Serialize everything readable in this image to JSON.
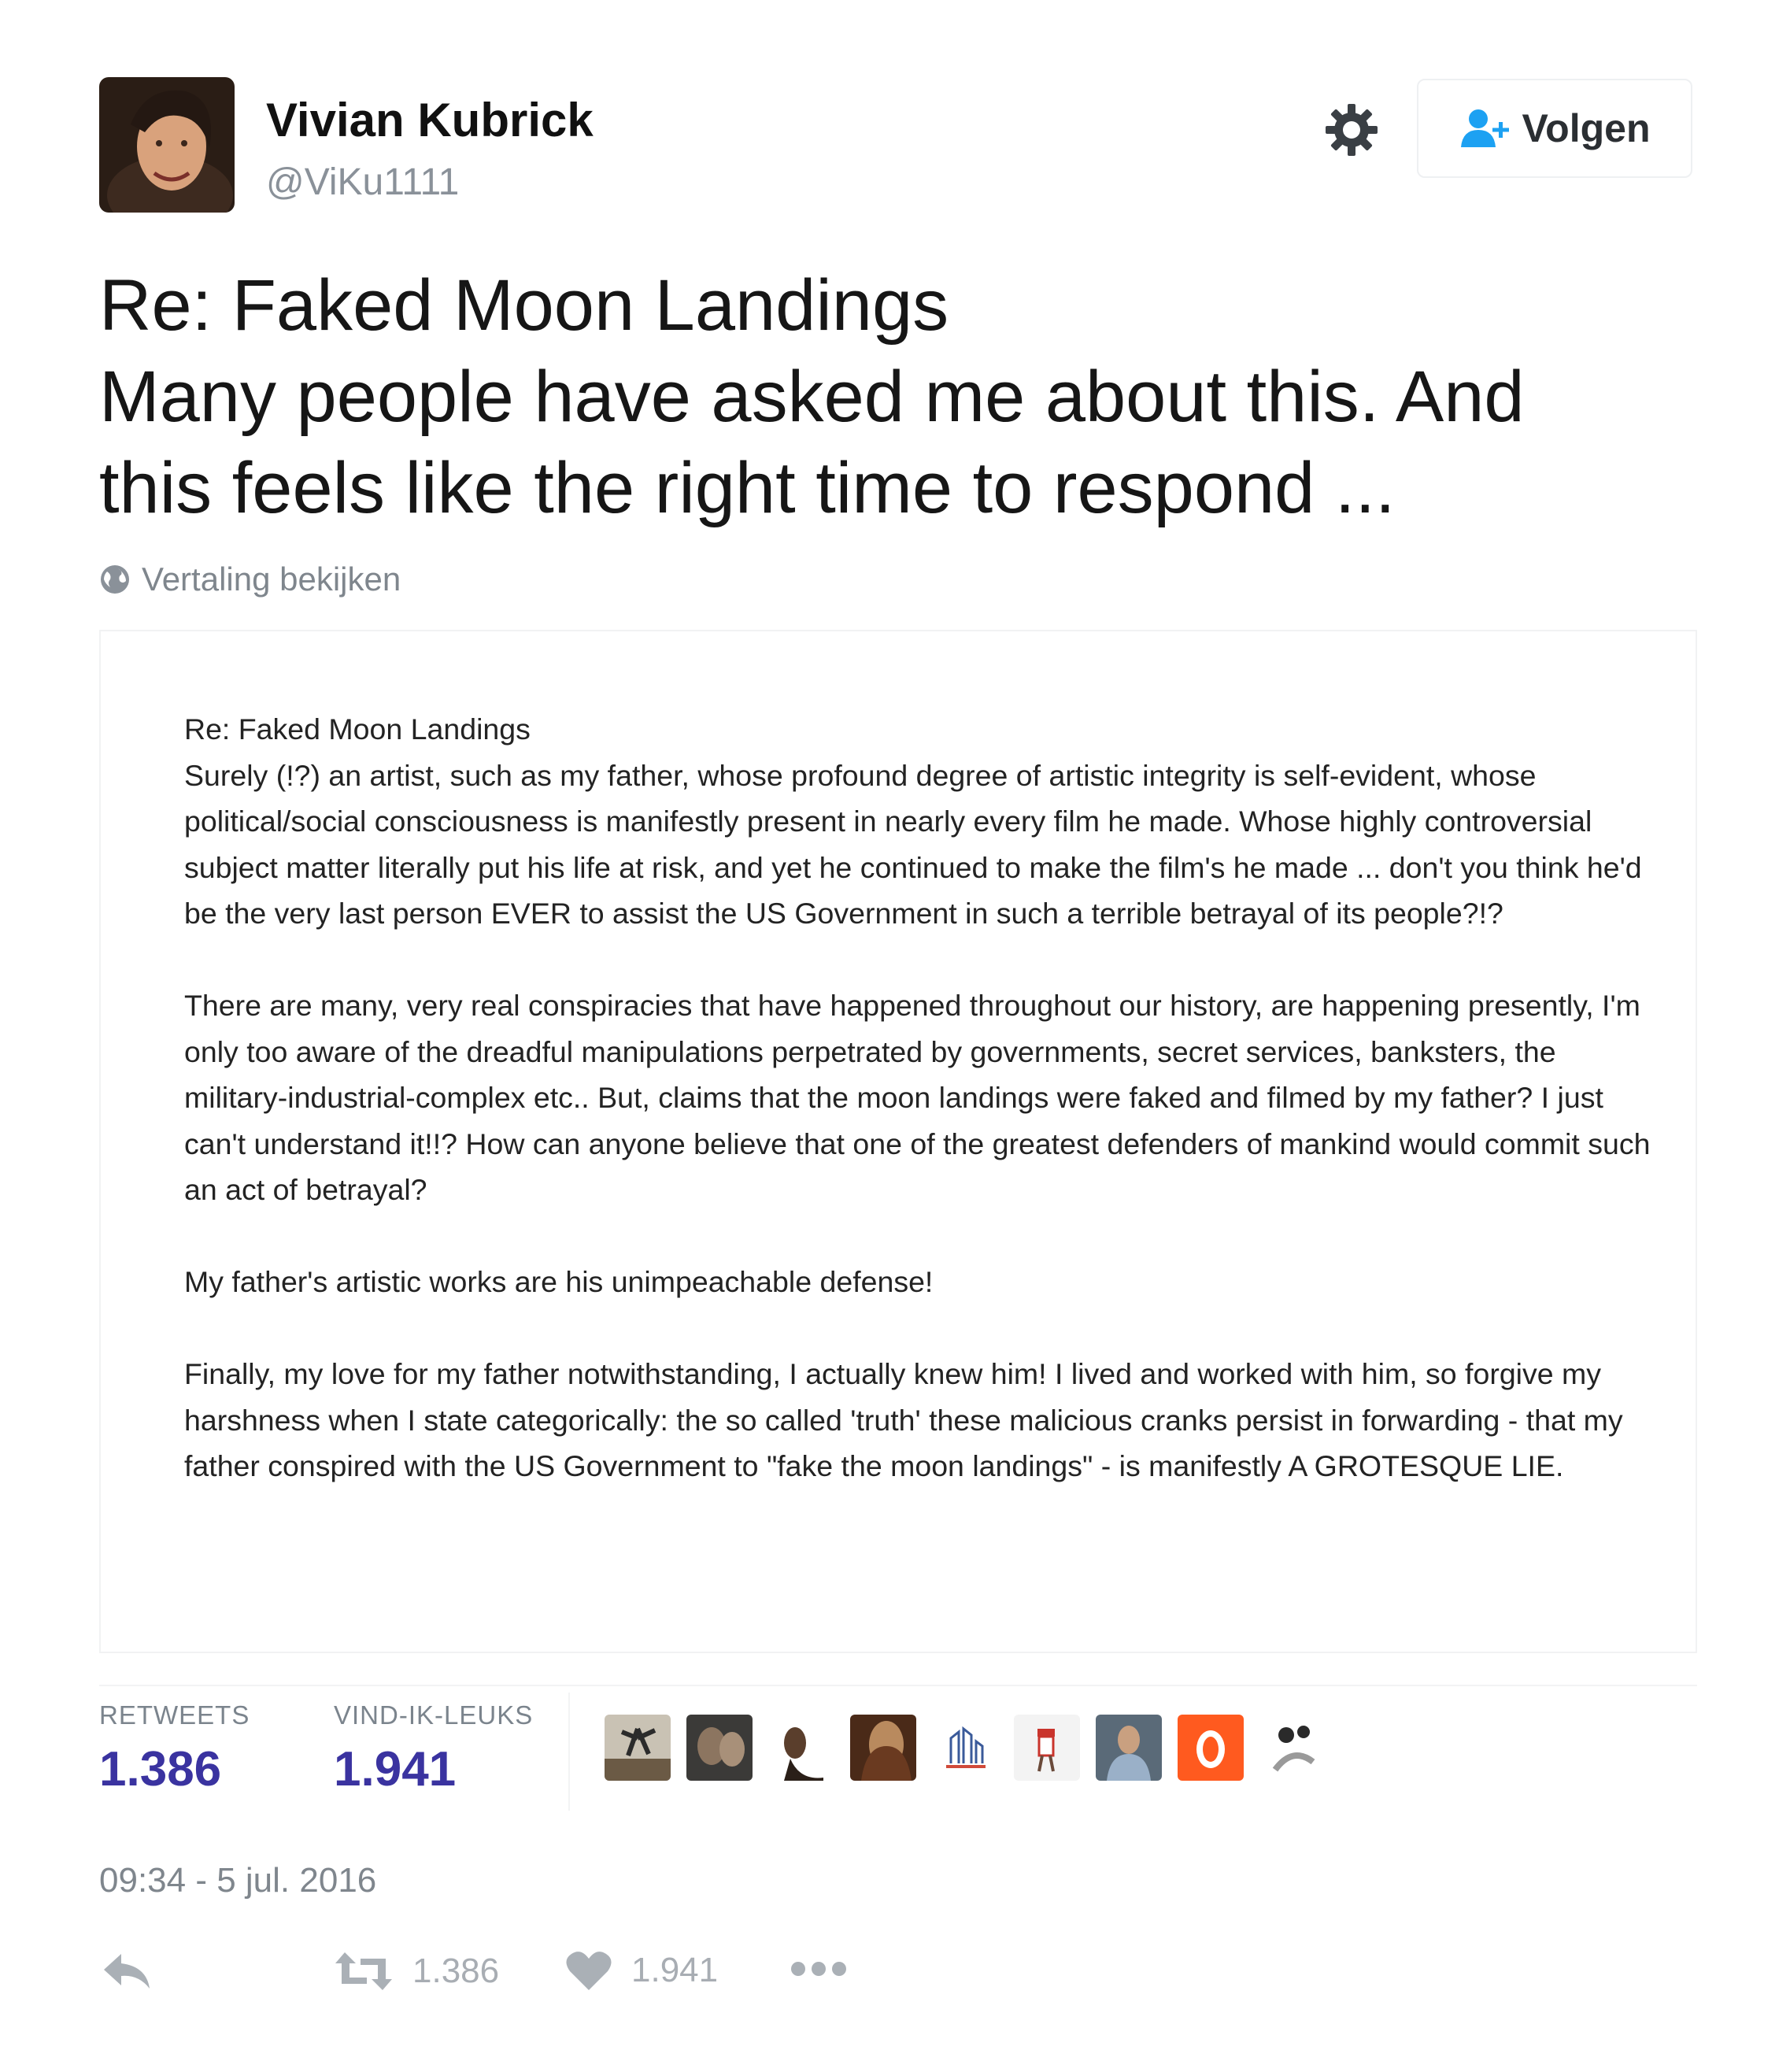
{
  "author": {
    "name": "Vivian Kubrick",
    "handle": "@ViKu1111"
  },
  "header": {
    "follow_label": "Volgen"
  },
  "tweet": {
    "lines": [
      "Re: Faked Moon Landings",
      "Many people have asked me about this. And",
      "this feels like the right time to respond ..."
    ],
    "translate_label": "Vertaling bekijken"
  },
  "card": {
    "title": "Re: Faked Moon Landings",
    "paragraphs": [
      "Surely (!?) an artist, such as my father, whose profound degree of artistic integrity is self-evident, whose political/social consciousness is manifestly present in nearly every film he made. Whose highly controversial subject matter literally put his life at risk, and yet he continued to make the film's he made ... don't you think he'd be the very last person EVER to assist the US Government in such a terrible betrayal of its people?!?",
      "There are many, very real conspiracies that have happened throughout our history, are happening presently, I'm only too aware of the dreadful manipulations perpetrated by governments, secret services, banksters, the military-industrial-complex etc.. But, claims that the moon landings were faked and filmed by my father? I just can't understand it!!? How can anyone believe that one of the greatest defenders of mankind would commit such an act of betrayal?",
      "My father's artistic works are his unimpeachable defense!",
      "Finally, my love for my father notwithstanding, I actually knew him! I lived and worked with him, so forgive my harshness when I state categorically: the so called 'truth' these malicious cranks persist in forwarding - that my father conspired with the US Government to \"fake the moon landings\" - is manifestly A GROTESQUE LIE."
    ]
  },
  "stats": {
    "retweets_label": "RETWEETS",
    "retweets": "1.386",
    "likes_label": "VIND-IK-LEUKS",
    "likes": "1.941"
  },
  "timestamp": "09:34 - 5 jul. 2016",
  "actions": {
    "retweet_count": "1.386",
    "like_count": "1.941"
  },
  "colors": {
    "stat_number": "#3a33a0",
    "follow_icon": "#1da1f2",
    "muted": "#7f868d"
  }
}
